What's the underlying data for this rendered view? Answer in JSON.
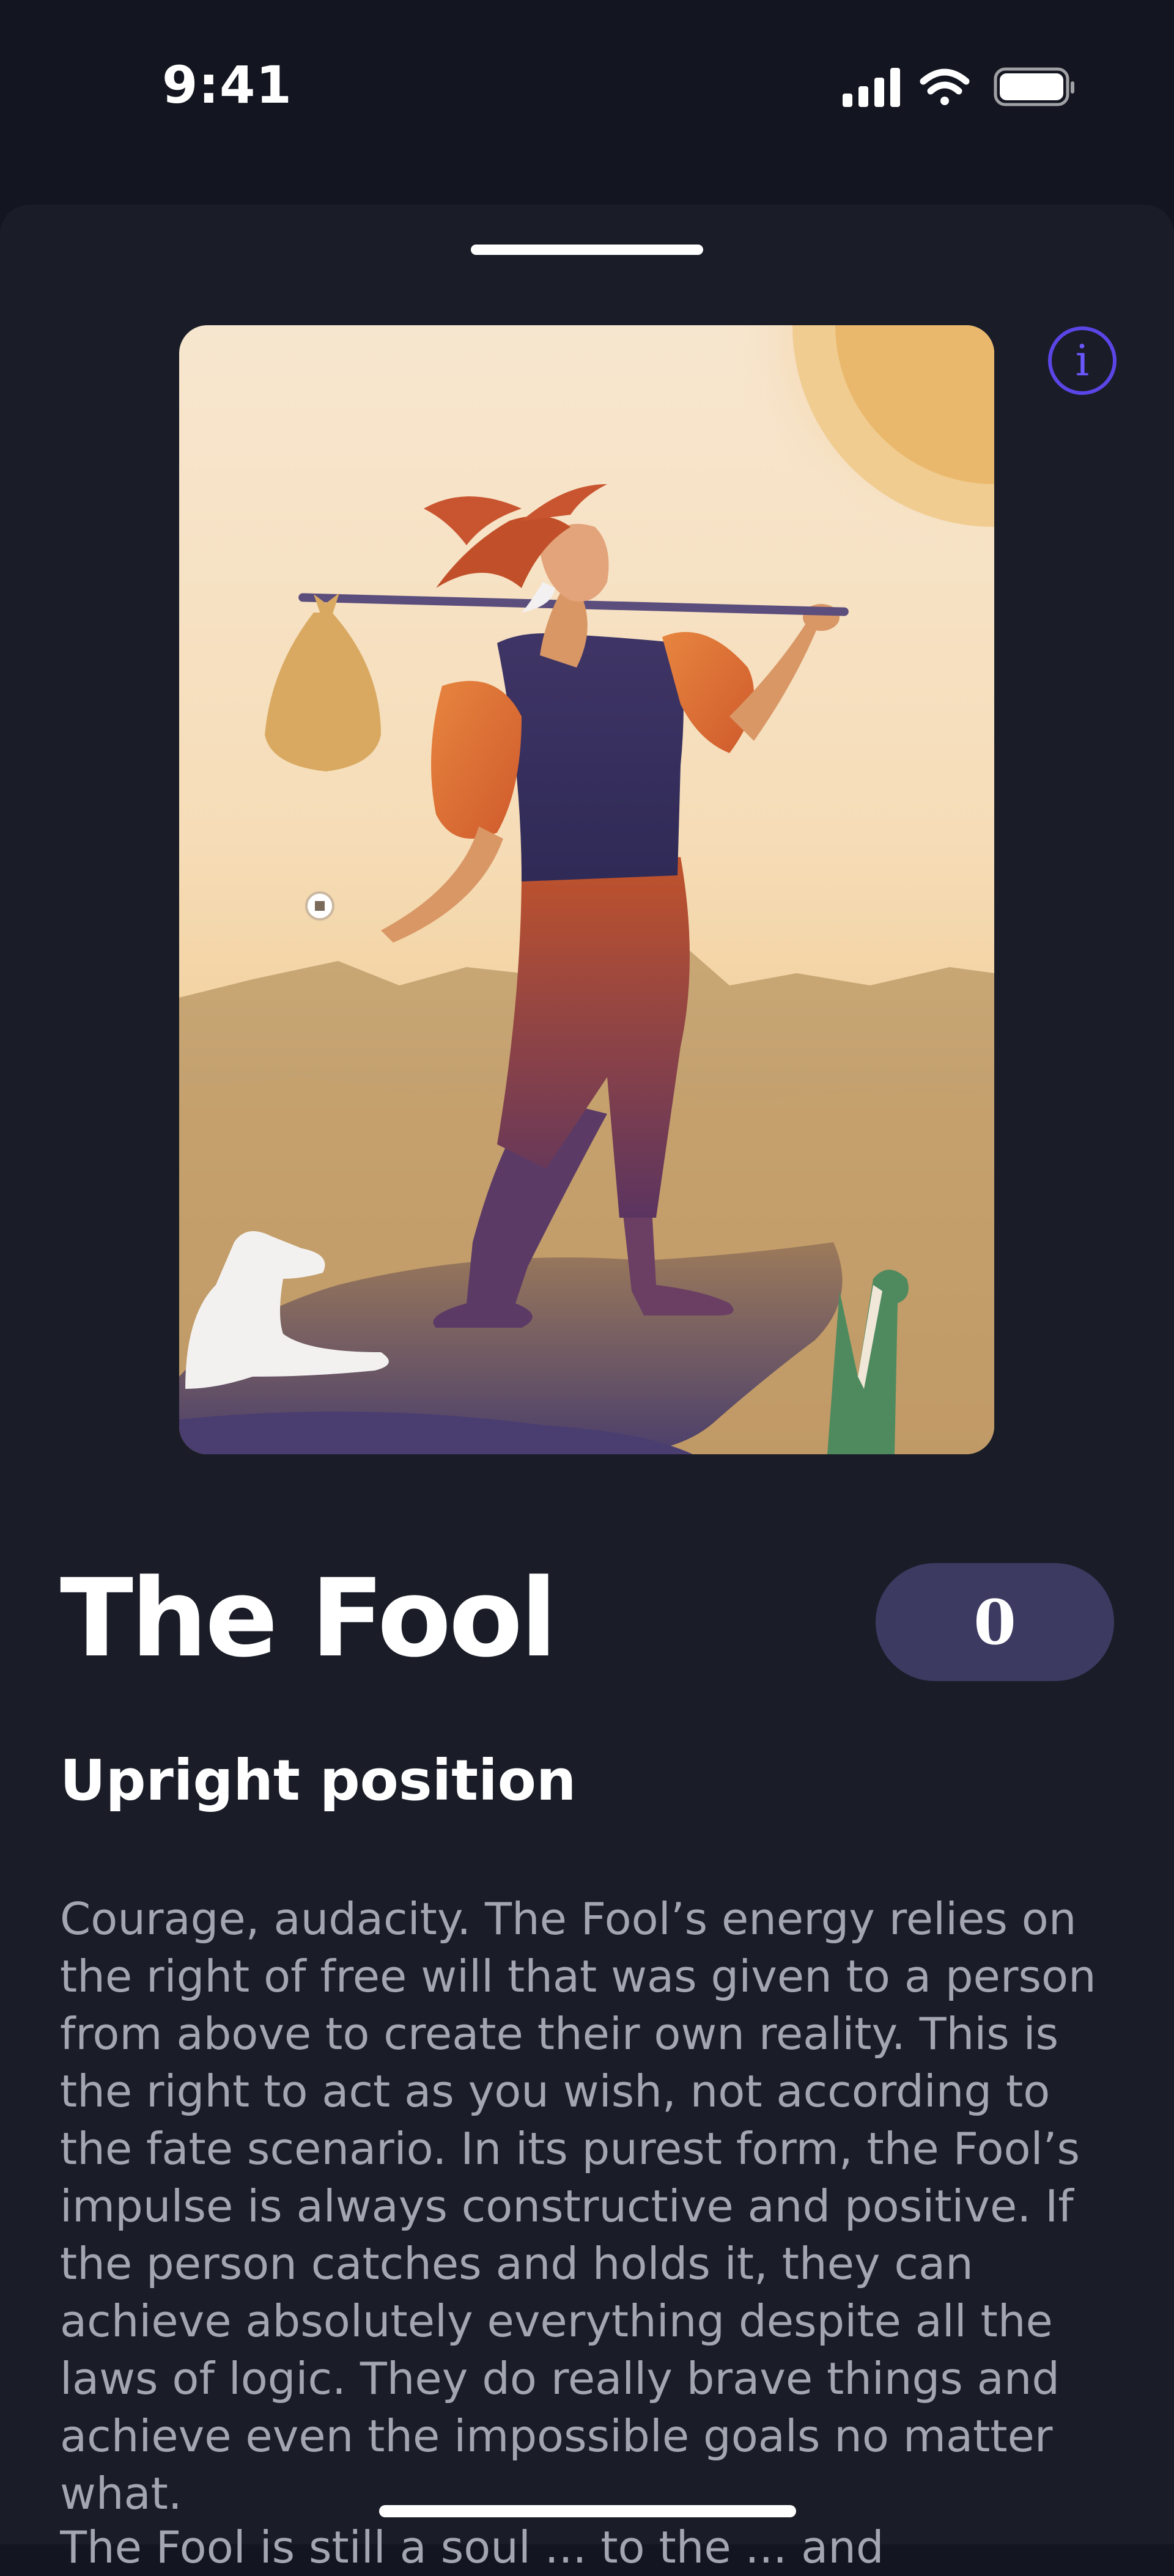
{
  "status_bar": {
    "time": "9:41"
  },
  "info_button": {
    "icon": "info-icon",
    "label": "i",
    "color": "#5a46e6"
  },
  "card": {
    "title": "The Fool",
    "number": "0",
    "illustration": "the-fool-card-image"
  },
  "section": {
    "heading": "Upright position",
    "description": "Courage, audacity. The Fool’s energy relies on the right of free will that was given to a person from above to create their own reality. This is the right to act as you wish, not according to the fate scenario. In its purest form, the Fool’s impulse is always constructive and positive. If the person catches and holds it, they can achieve absolutely everything despite all the laws of logic. They do really brave things and achieve even the impossible goals no matter what.",
    "next_paragraph_start": "The Fool is still a soul ... to the ... and"
  },
  "colors": {
    "background": "#131620",
    "sheet": "#1a1d28",
    "badge": "#3c3a61",
    "body_text": "#a3a5b0"
  }
}
